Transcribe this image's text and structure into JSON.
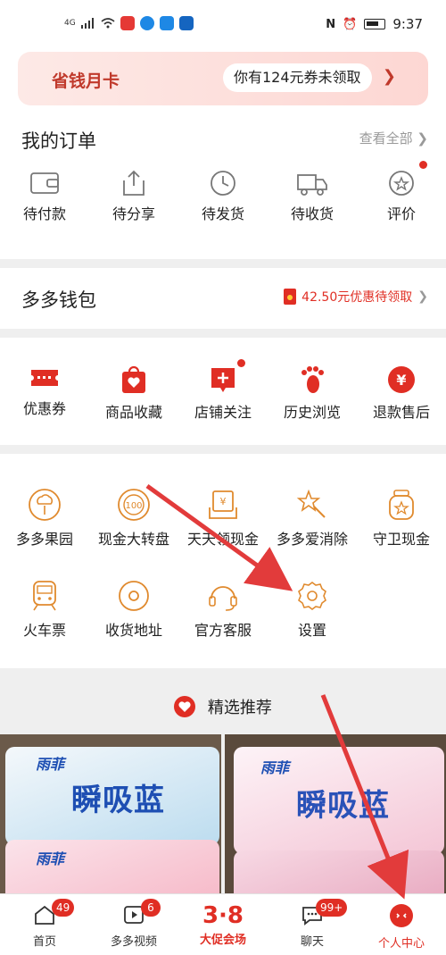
{
  "status_bar": {
    "signal": "4G",
    "time": "9:37"
  },
  "banner": {
    "title": "省钱月卡",
    "coupon_text": "你有124元券未领取"
  },
  "orders": {
    "title": "我的订单",
    "view_all": "查看全部",
    "items": [
      {
        "label": "待付款",
        "icon": "wallet-icon"
      },
      {
        "label": "待分享",
        "icon": "share-icon"
      },
      {
        "label": "待发货",
        "icon": "clock-icon"
      },
      {
        "label": "待收货",
        "icon": "truck-icon"
      },
      {
        "label": "评价",
        "icon": "review-icon"
      }
    ]
  },
  "wallet": {
    "title": "多多钱包",
    "promo": "42.50元优惠待领取"
  },
  "quick": {
    "items": [
      {
        "label": "优惠券",
        "icon": "coupon-icon"
      },
      {
        "label": "商品收藏",
        "icon": "bag-heart-icon"
      },
      {
        "label": "店铺关注",
        "icon": "store-plus-icon"
      },
      {
        "label": "历史浏览",
        "icon": "footprint-icon"
      },
      {
        "label": "退款售后",
        "icon": "yen-icon"
      }
    ]
  },
  "tools": {
    "row1": [
      {
        "label": "多多果园",
        "icon": "tree-icon"
      },
      {
        "label": "现金大转盘",
        "icon": "wheel-icon"
      },
      {
        "label": "天天领现金",
        "icon": "cash-icon"
      },
      {
        "label": "多多爱消除",
        "icon": "star-wand-icon"
      },
      {
        "label": "守卫现金",
        "icon": "jar-icon"
      }
    ],
    "row2": [
      {
        "label": "火车票",
        "icon": "train-icon"
      },
      {
        "label": "收货地址",
        "icon": "location-icon"
      },
      {
        "label": "官方客服",
        "icon": "headset-icon"
      },
      {
        "label": "设置",
        "icon": "gear-icon"
      }
    ]
  },
  "recommend": {
    "title": "精选推荐"
  },
  "products": [
    {
      "brand": "雨菲",
      "name": "瞬吸蓝"
    },
    {
      "brand": "雨菲",
      "name": "瞬吸蓝"
    }
  ],
  "tabbar": {
    "items": [
      {
        "label": "首页",
        "badge": "49"
      },
      {
        "label": "多多视频",
        "badge": "6"
      },
      {
        "label": "大促会场",
        "badge": "",
        "big": "3·8"
      },
      {
        "label": "聊天",
        "badge": "99+"
      },
      {
        "label": "个人中心",
        "badge": ""
      }
    ]
  },
  "colors": {
    "brand_red": "#e02e24",
    "tool_orange": "#e08a2e"
  }
}
